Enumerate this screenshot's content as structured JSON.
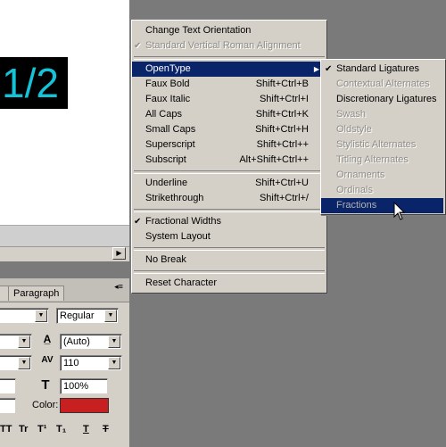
{
  "canvas": {
    "sample_text": "1/2"
  },
  "panel": {
    "tabs": [
      "Paragraph"
    ],
    "font_style": "Regular",
    "leading": "(Auto)",
    "tracking": "110",
    "vertical_scale": "100%",
    "color_label": "Color:",
    "colors": {
      "swatch": "#c82020",
      "sample_text": "#15c3d8",
      "menu_highlight": "#0a246a"
    },
    "type_buttons": [
      "TT",
      "Tr",
      "T¹",
      "T₁",
      "T",
      "T"
    ]
  },
  "menu": {
    "items": [
      {
        "label": "Change Text Orientation",
        "shortcut": ""
      },
      {
        "label": "Standard Vertical Roman Alignment",
        "shortcut": ""
      },
      {
        "label": "OpenType",
        "shortcut": ""
      },
      {
        "label": "Faux Bold",
        "shortcut": "Shift+Ctrl+B"
      },
      {
        "label": "Faux Italic",
        "shortcut": "Shift+Ctrl+I"
      },
      {
        "label": "All Caps",
        "shortcut": "Shift+Ctrl+K"
      },
      {
        "label": "Small Caps",
        "shortcut": "Shift+Ctrl+H"
      },
      {
        "label": "Superscript",
        "shortcut": "Shift+Ctrl++"
      },
      {
        "label": "Subscript",
        "shortcut": "Alt+Shift+Ctrl++"
      },
      {
        "label": "Underline",
        "shortcut": "Shift+Ctrl+U"
      },
      {
        "label": "Strikethrough",
        "shortcut": "Shift+Ctrl+/"
      },
      {
        "label": "Fractional Widths",
        "shortcut": ""
      },
      {
        "label": "System Layout",
        "shortcut": ""
      },
      {
        "label": "No Break",
        "shortcut": ""
      },
      {
        "label": "Reset Character",
        "shortcut": ""
      }
    ]
  },
  "submenu": {
    "items": [
      "Standard Ligatures",
      "Contextual Alternates",
      "Discretionary Ligatures",
      "Swash",
      "Oldstyle",
      "Stylistic Alternates",
      "Titling Alternates",
      "Ornaments",
      "Ordinals",
      "Fractions"
    ]
  },
  "icons": {
    "check": "checkmark-icon",
    "submenu_arrow": "triangle-right-icon",
    "cursor": "mouse-pointer-icon"
  }
}
